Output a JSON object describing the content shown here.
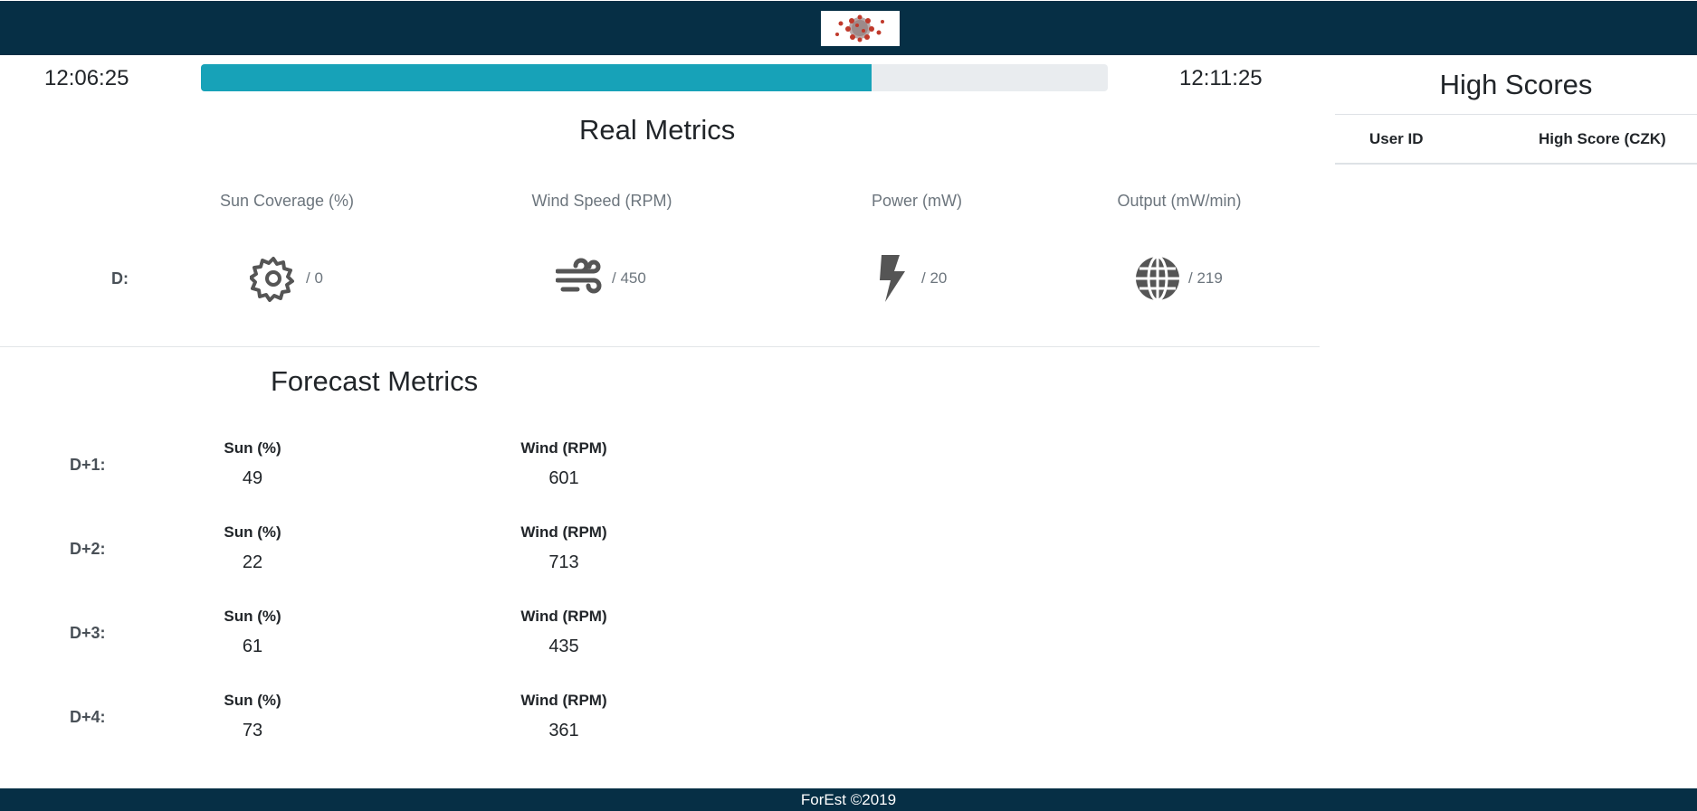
{
  "header": {
    "logo_icon": "virus-logo-icon",
    "background_color": "#062f45"
  },
  "timer": {
    "start_time": "12:06:25",
    "end_time": "12:11:25",
    "progress_fraction": 0.74,
    "progress_color": "#17a2b8"
  },
  "real_metrics": {
    "title": "Real Metrics",
    "row_label": "D:",
    "items": [
      {
        "label": "Sun Coverage (%)",
        "icon": "gear-icon",
        "value": "/ 0"
      },
      {
        "label": "Wind Speed (RPM)",
        "icon": "wind-icon",
        "value": "/ 450"
      },
      {
        "label": "Power (mW)",
        "icon": "bolt-icon",
        "value": "/ 20"
      },
      {
        "label": "Output (mW/min)",
        "icon": "globe-icon",
        "value": "/ 219"
      }
    ]
  },
  "forecast_metrics": {
    "title": "Forecast Metrics",
    "rows": [
      {
        "day": "D+1:",
        "sun_label": "Sun (%)",
        "sun": "49",
        "wind_label": "Wind (RPM)",
        "wind": "601"
      },
      {
        "day": "D+2:",
        "sun_label": "Sun (%)",
        "sun": "22",
        "wind_label": "Wind (RPM)",
        "wind": "713"
      },
      {
        "day": "D+3:",
        "sun_label": "Sun (%)",
        "sun": "61",
        "wind_label": "Wind (RPM)",
        "wind": "435"
      },
      {
        "day": "D+4:",
        "sun_label": "Sun (%)",
        "sun": "73",
        "wind_label": "Wind (RPM)",
        "wind": "361"
      }
    ]
  },
  "high_scores": {
    "title": "High Scores",
    "columns": [
      "User ID",
      "High Score (CZK)"
    ],
    "rows": []
  },
  "footer": {
    "text": "ForEst ©2019"
  }
}
